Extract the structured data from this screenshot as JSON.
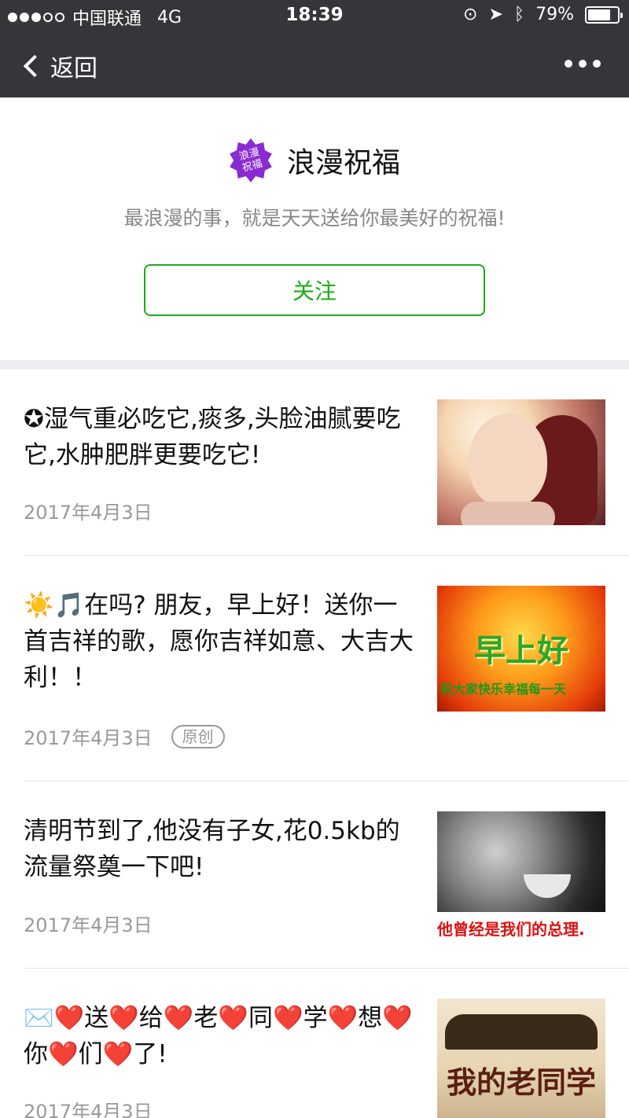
{
  "status_bar": {
    "carrier": "中国联通",
    "network": "4G",
    "time": "18:39",
    "battery": "79%",
    "battery_level": 0.79
  },
  "nav": {
    "back_label": "返回"
  },
  "profile": {
    "logo_text": "浪漫祝福",
    "name": "浪漫祝福",
    "description": "最浪漫的事，就是天天送给你最美好的祝福!",
    "follow_label": "关注",
    "accent_color": "#1aad19"
  },
  "articles": [
    {
      "title": "✪湿气重必吃它,痰多,头脸油腻要吃它,水肿肥胖更要吃它!",
      "date": "2017年4月3日",
      "tag": ""
    },
    {
      "title": "☀️🎵在吗? 朋友，早上好！送你一首吉祥的歌，愿你吉祥如意、大吉大利！！",
      "date": "2017年4月3日",
      "tag": "原创",
      "thumb_text": "早上好",
      "thumb_subtext": "祝大家快乐幸福每一天"
    },
    {
      "title": "清明节到了,他没有子女,花0.5kb的流量祭奠一下吧!",
      "date": "2017年4月3日",
      "tag": "",
      "thumb_caption": "他曾经是我们的总理."
    },
    {
      "title": "✉️❤️送❤️给❤️老❤️同❤️学❤️想❤️你❤️们❤️了!",
      "date": "2017年4月3日",
      "tag": "",
      "thumb_text": "我的老同学"
    }
  ]
}
